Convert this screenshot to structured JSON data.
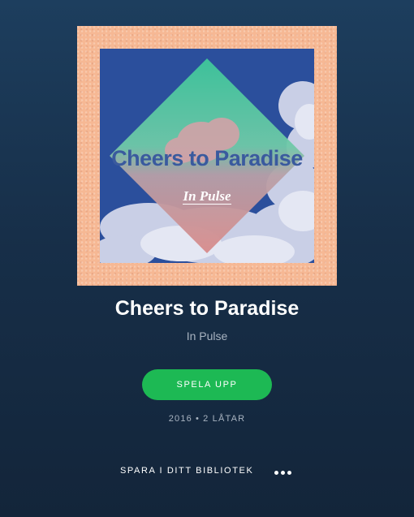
{
  "album": {
    "art_title": "Cheers to Paradise",
    "art_artist": "In Pulse",
    "title": "Cheers to Paradise",
    "artist": "In Pulse",
    "year": "2016",
    "separator": "•",
    "track_count": "2 LÅTAR"
  },
  "actions": {
    "play_label": "SPELA UPP",
    "save_label": "SPARA I DITT BIBLIOTEK",
    "more_icon": "more-horizontal-icon"
  },
  "colors": {
    "accent": "#1db954",
    "frame": "#f6b894",
    "art_background": "#2b4f9c",
    "diamond_top": "#3cc497",
    "diamond_bottom": "#d98a8a"
  }
}
